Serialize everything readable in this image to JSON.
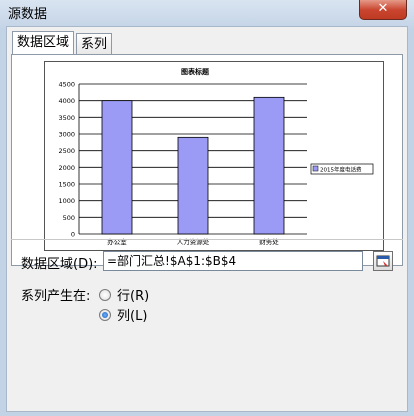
{
  "window": {
    "title": "源数据",
    "close_glyph": "✕"
  },
  "tabs": [
    {
      "label": "数据区域",
      "active": true
    },
    {
      "label": "系列",
      "active": false
    }
  ],
  "chart_data": {
    "type": "bar",
    "title": "图表标题",
    "categories": [
      "办公室",
      "人力资源处",
      "财务处"
    ],
    "series": [
      {
        "name": "2015年度电话费",
        "values": [
          4000,
          2900,
          4100
        ],
        "color": "#9b9bf5"
      }
    ],
    "ylim": [
      0,
      4500
    ],
    "yticks": [
      0,
      500,
      1000,
      1500,
      2000,
      2500,
      3000,
      3500,
      4000,
      4500
    ],
    "grid": true,
    "legend": "right"
  },
  "data_range": {
    "label": "数据区域(D):",
    "value": "=部门汇总!$A$1:$B$4"
  },
  "series_in": {
    "label": "系列产生在:",
    "options": [
      {
        "label": "行(R)",
        "selected": false
      },
      {
        "label": "列(L)",
        "selected": true
      }
    ]
  }
}
